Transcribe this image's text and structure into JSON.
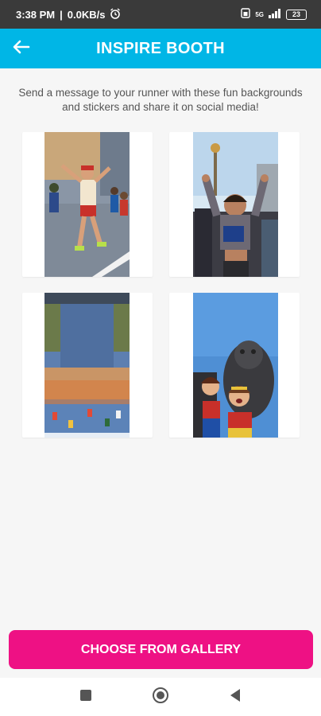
{
  "status_bar": {
    "time": "3:38 PM",
    "speed": "0.0KB/s",
    "alarm_icon": "alarm-clock-icon",
    "network_label": "5G",
    "battery": "23"
  },
  "header": {
    "title": "INSPIRE BOOTH",
    "back_icon": "arrow-left-icon",
    "background": "#00b6e6"
  },
  "intro_text": "Send a message to your runner with these fun backgrounds and stickers and share it on social media!",
  "backgrounds": [
    {
      "name": "runner-with-hat-on-street"
    },
    {
      "name": "cheering-woman-runner"
    },
    {
      "name": "marathon-crowd-aerial"
    },
    {
      "name": "wonder-women-with-gorilla"
    }
  ],
  "gallery_button": {
    "label": "CHOOSE FROM GALLERY",
    "color": "#ee1184"
  },
  "nav_bar": {
    "recent_icon": "square-icon",
    "home_icon": "circle-home-icon",
    "back_icon": "triangle-back-icon"
  }
}
